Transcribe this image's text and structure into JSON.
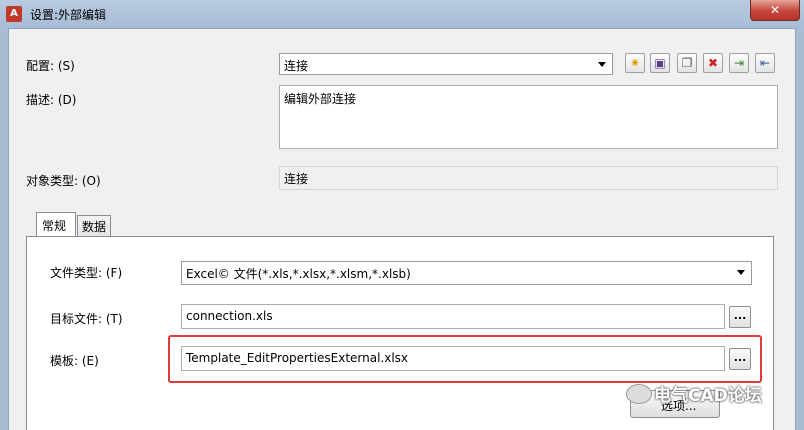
{
  "window": {
    "title": "设置:外部编辑",
    "close_label": "✕",
    "app_icon": "A"
  },
  "config": {
    "label": "配置: (S)",
    "value": "连接"
  },
  "toolbar": {
    "buttons": [
      {
        "icon": "new-star-icon",
        "glyph": "✷",
        "color": "#e0a000"
      },
      {
        "icon": "save-icon",
        "glyph": "▣",
        "color": "#5a3f8a"
      },
      {
        "icon": "copy-icon",
        "glyph": "❐",
        "color": "#555555"
      },
      {
        "icon": "delete-icon",
        "glyph": "✖",
        "color": "#d02020"
      },
      {
        "icon": "import-icon",
        "glyph": "⇥",
        "color": "#3a8a2a"
      },
      {
        "icon": "export-icon",
        "glyph": "⇤",
        "color": "#3a5aa0"
      }
    ]
  },
  "description": {
    "label": "描述: (D)",
    "value": "编辑外部连接"
  },
  "object_type": {
    "label": "对象类型: (O)",
    "value": "连接"
  },
  "tabs": [
    {
      "label": "常规"
    },
    {
      "label": "数据"
    }
  ],
  "file_type": {
    "label": "文件类型: (F)",
    "value": "Excel© 文件(*.xls,*.xlsx,*.xlsm,*.xlsb)"
  },
  "target_file": {
    "label": "目标文件: (T)",
    "value": "connection.xls",
    "browse_label": "..."
  },
  "template": {
    "label": "模板: (E)",
    "value": "Template_EditPropertiesExternal.xlsx",
    "browse_label": "..."
  },
  "preview_button": {
    "label": "选项..."
  },
  "watermark": {
    "text": "电气CAD论坛"
  },
  "colors": {
    "highlight": "#e03a3a",
    "titlebar": "#b0c4de",
    "close": "#c6453a"
  }
}
